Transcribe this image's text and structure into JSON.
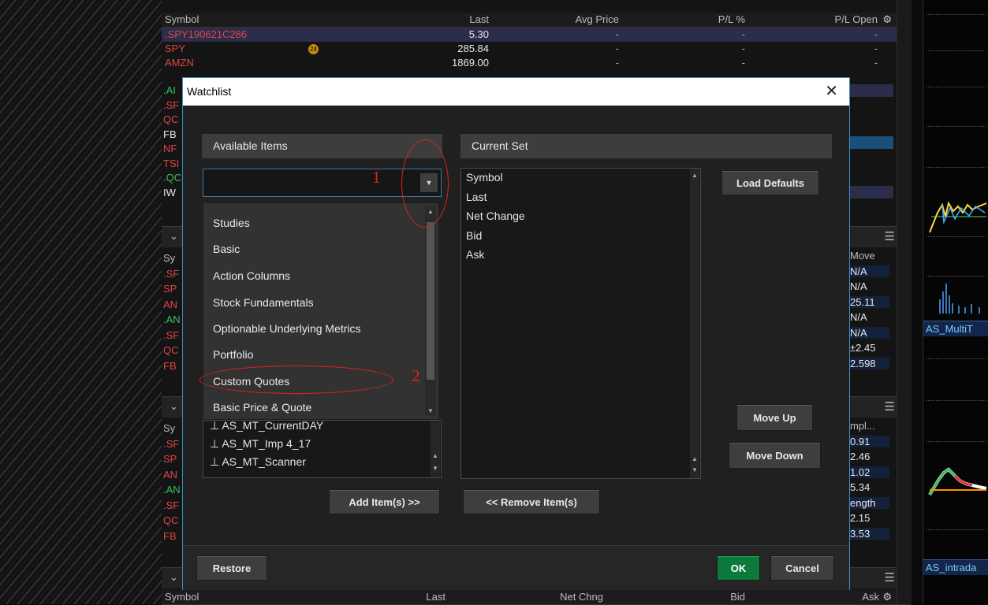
{
  "background_table": {
    "header": {
      "symbol": "Symbol",
      "last": "Last",
      "avg_price": "Avg Price",
      "pl_pct": "P/L %",
      "pl_open": "P/L Open"
    },
    "rows": [
      {
        "symbol": ".SPY190621C286",
        "last": "5.30",
        "color": "#e04545",
        "highlight": true,
        "badge": ""
      },
      {
        "symbol": "SPY",
        "last": "285.84",
        "color": "#e04545",
        "highlight": false,
        "badge": "24"
      },
      {
        "symbol": "AMZN",
        "last": "1869.00",
        "color": "#e04545",
        "highlight": false,
        "badge": ""
      }
    ],
    "partial_symbols_1": [
      ".AI",
      ".SF",
      "QC",
      "FB",
      "NF",
      "TSI",
      ".QC",
      "IW"
    ],
    "partial_colors_1": [
      "#35c35a",
      "#e04545",
      "#e04545",
      "#e8e8e8",
      "#e04545",
      "#e04545",
      "#35c35a",
      "#e8e8e8"
    ],
    "partial_symbols_2": [
      "Sy",
      ".SF",
      "SP",
      "AN",
      ".AN",
      ".SF",
      "QC",
      "FB"
    ],
    "partial_colors_2": [
      "#bcbcbc",
      "#e04545",
      "#e04545",
      "#e04545",
      "#35c35a",
      "#e04545",
      "#e04545",
      "#e04545"
    ],
    "partial_symbols_3": [
      "Sy",
      ".SF",
      "SP",
      "AN",
      ".AN",
      ".SF",
      "QC",
      "FB"
    ],
    "partial_colors_3": [
      "#bcbcbc",
      "#e04545",
      "#e04545",
      "#e04545",
      "#35c35a",
      "#e04545",
      "#e04545",
      "#e04545"
    ],
    "right_col_1_header": "Move",
    "right_col_1": [
      "N/A",
      "N/A",
      "25.11",
      "N/A",
      "N/A",
      "±2.45",
      "2.598"
    ],
    "right_col_2_header": "mpl...",
    "right_col_2": [
      "0.91",
      "2.46",
      "1.02",
      "5.34",
      "ength",
      "2.15",
      "3.53"
    ],
    "bottom_header": {
      "symbol": "Symbol",
      "last": "Last",
      "net_chng": "Net Chng",
      "bid": "Bid",
      "ask": "Ask"
    },
    "dash": "-"
  },
  "right_charts": {
    "label_1": "AS_MultiT",
    "label_2": "AS_intrada"
  },
  "dialog": {
    "title": "Watchlist",
    "close_glyph": "✕",
    "available_header": "Available Items",
    "current_header": "Current Set",
    "combo_value": "",
    "dropdown_items": [
      "Studies",
      "Basic",
      "Action Columns",
      "Stock Fundamentals",
      "Optionable Underlying Metrics",
      "Portfolio",
      "Custom Quotes",
      "Basic Price & Quote"
    ],
    "template_items": [
      "AS_MT_CurrentDAY",
      "AS_MT_Imp 4_17",
      "AS_MT_Scanner"
    ],
    "current_set": [
      "Symbol",
      "Last",
      "Net Change",
      "Bid",
      "Ask"
    ],
    "buttons": {
      "load_defaults": "Load Defaults",
      "move_up": "Move Up",
      "move_down": "Move Down",
      "add_items": "Add Item(s) >>",
      "remove_items": "<< Remove Item(s)",
      "restore": "Restore",
      "ok": "OK",
      "cancel": "Cancel"
    },
    "annotations": {
      "num_1": "1",
      "num_2": "2"
    }
  }
}
